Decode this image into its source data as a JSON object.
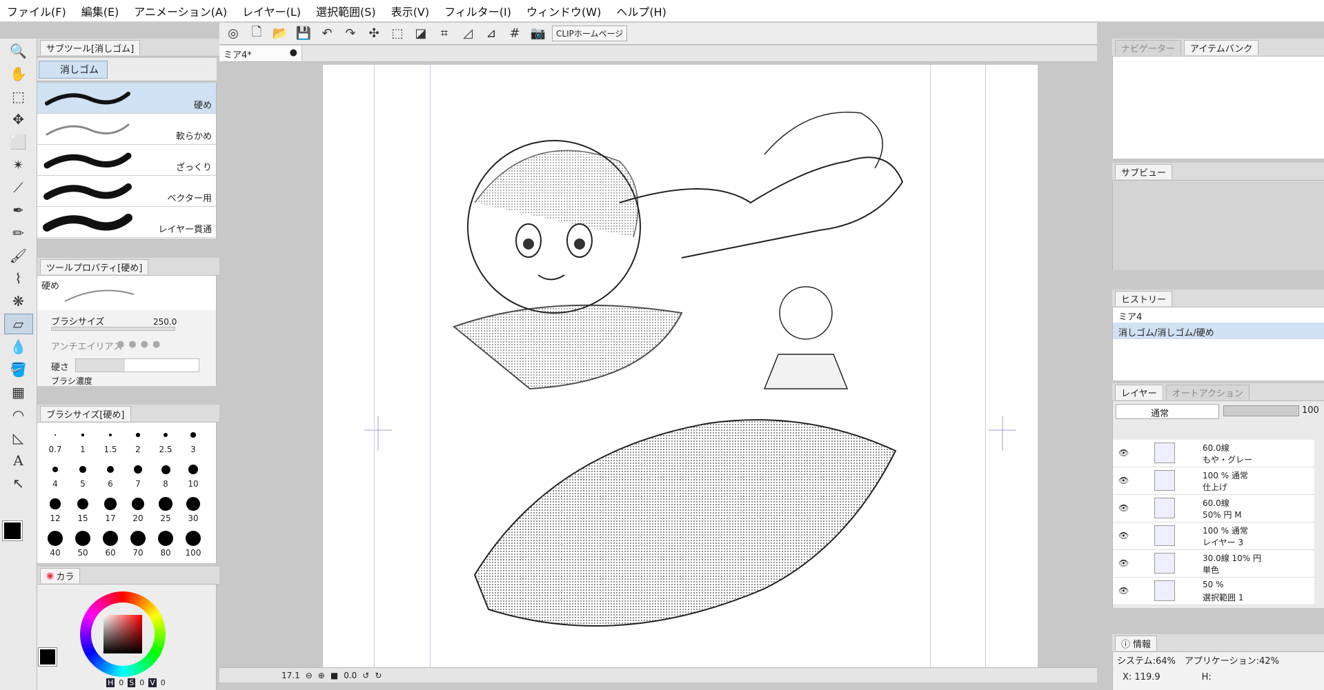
{
  "menu": [
    "ファイル(F)",
    "編集(E)",
    "アニメーション(A)",
    "レイヤー(L)",
    "選択範囲(S)",
    "表示(V)",
    "フィルター(I)",
    "ウィンドウ(W)",
    "ヘルプ(H)"
  ],
  "subtool": {
    "title": "サブツール[消しゴム]",
    "group": "消しゴム",
    "brushes": [
      "硬め",
      "軟らかめ",
      "ざっくり",
      "ベクター用",
      "レイヤー貫通"
    ]
  },
  "toolprop": {
    "title": "ツールプロパティ[硬め]",
    "preset": "硬め",
    "brush_size_label": "ブラシサイズ",
    "brush_size_value": "250.0",
    "antialias_label": "アンチエイリアス",
    "hardness_label": "硬さ",
    "density_label": "ブラシ濃度"
  },
  "brushsize": {
    "title": "ブラシサイズ[硬め]",
    "sizes": [
      "0.7",
      "1",
      "1.5",
      "2",
      "2.5",
      "3",
      "4",
      "5",
      "6",
      "7",
      "8",
      "10",
      "12",
      "15",
      "17",
      "20",
      "25",
      "30",
      "40",
      "50",
      "60",
      "70",
      "80",
      "100"
    ]
  },
  "color": {
    "tab": "カラ",
    "h_label": "H",
    "h": "0",
    "s_label": "S",
    "s": "0",
    "v_label": "V",
    "v": "0"
  },
  "toolbar": {
    "clip_home": "CLIPホームページ"
  },
  "document": {
    "tab": "ミア4*",
    "zoom": "17.1",
    "rotate": "0.0"
  },
  "navigator": {
    "tab": "ナビゲーター",
    "item_bank": "アイテムバンク"
  },
  "subview": {
    "tab": "サブビュー"
  },
  "history": {
    "tab": "ヒストリー",
    "items": [
      "ミア4",
      "消しゴム/消しゴム/硬め"
    ]
  },
  "layers": {
    "tab": "レイヤー",
    "auto_action": "オートアクション",
    "blend": "通常",
    "opacity": "100",
    "items": [
      {
        "line1": "60.0線",
        "line2": "もや・グレー"
      },
      {
        "line1": "100 % 通常",
        "line2": "仕上げ"
      },
      {
        "line1": "60.0線",
        "line2": "50% 円 M"
      },
      {
        "line1": "100 % 通常",
        "line2": "レイヤー 3"
      },
      {
        "line1": "30.0線 10% 円",
        "line2": "単色"
      },
      {
        "line1": "50 %",
        "line2": "選択範囲 1"
      }
    ]
  },
  "info": {
    "tab": "情報",
    "system": "システム:64%",
    "app": "アプリケーション:42%",
    "x": "X: 119.9",
    "h": "H:"
  }
}
